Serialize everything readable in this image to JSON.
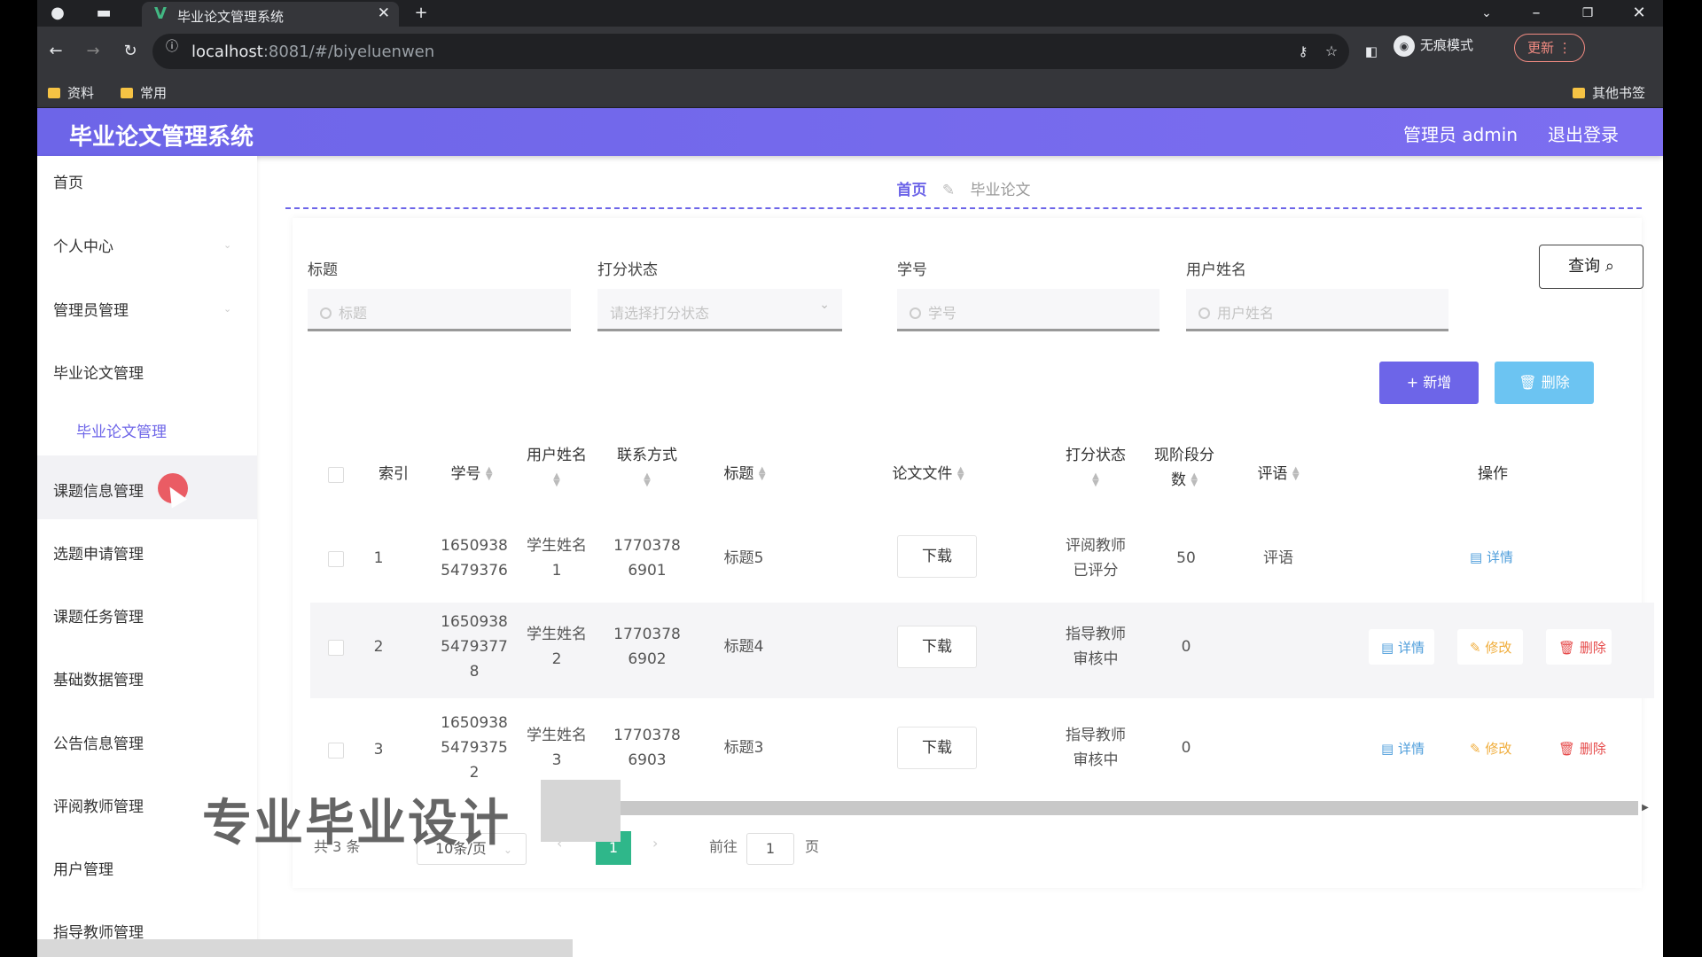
{
  "browser": {
    "tab_title": "毕业论文管理系统",
    "url_host": "localhost",
    "url_rest": ":8081/#/biyeluenwen",
    "bookmarks": [
      "资料",
      "常用"
    ],
    "other_bookmarks": "其他书签",
    "incognito_label": "无痕模式",
    "update_label": "更新"
  },
  "header": {
    "title": "毕业论文管理系统",
    "user": "管理员 admin",
    "logout": "退出登录"
  },
  "sidebar": {
    "items": [
      {
        "label": "首页"
      },
      {
        "label": "个人中心"
      },
      {
        "label": "管理员管理"
      },
      {
        "label": "毕业论文管理"
      },
      {
        "label": "毕业论文管理"
      },
      {
        "label": "课题信息管理"
      },
      {
        "label": "选题申请管理"
      },
      {
        "label": "课题任务管理"
      },
      {
        "label": "基础数据管理"
      },
      {
        "label": "公告信息管理"
      },
      {
        "label": "评阅教师管理"
      },
      {
        "label": "用户管理"
      },
      {
        "label": "指导教师管理"
      }
    ]
  },
  "breadcrumb": {
    "home": "首页",
    "current": "毕业论文"
  },
  "filters": {
    "title_label": "标题",
    "title_placeholder": "标题",
    "status_label": "打分状态",
    "status_placeholder": "请选择打分状态",
    "student_no_label": "学号",
    "student_no_placeholder": "学号",
    "username_label": "用户姓名",
    "username_placeholder": "用户姓名",
    "query": "查询"
  },
  "actions": {
    "add": "新增",
    "delete": "删除"
  },
  "table": {
    "headers": {
      "index": "索引",
      "student_no": "学号",
      "username": "用户姓名",
      "contact": "联系方式",
      "title": "标题",
      "file": "论文文件",
      "status": "打分状态",
      "score_a": "现阶段分",
      "score_b": "数",
      "comment": "评语",
      "ops": "操作"
    },
    "rows": [
      {
        "index": "1",
        "no1": "1650938",
        "no2": "5479376",
        "no3": "",
        "name1": "学生姓名",
        "name2": "1",
        "tel1": "1770378",
        "tel2": "6901",
        "title": "标题5",
        "file": "下载",
        "st1": "评阅教师",
        "st2": "已评分",
        "score": "50",
        "comment": "评语",
        "detail": "详情",
        "edit": "",
        "remove": ""
      },
      {
        "index": "2",
        "no1": "1650938",
        "no2": "5479377",
        "no3": "8",
        "name1": "学生姓名",
        "name2": "2",
        "tel1": "1770378",
        "tel2": "6902",
        "title": "标题4",
        "file": "下载",
        "st1": "指导教师",
        "st2": "审核中",
        "score": "0",
        "comment": "",
        "detail": "详情",
        "edit": "修改",
        "remove": "删除"
      },
      {
        "index": "3",
        "no1": "1650938",
        "no2": "5479375",
        "no3": "2",
        "name1": "学生姓名",
        "name2": "3",
        "tel1": "1770378",
        "tel2": "6903",
        "title": "标题3",
        "file": "下载",
        "st1": "指导教师",
        "st2": "审核中",
        "score": "0",
        "comment": "",
        "detail": "详情",
        "edit": "修改",
        "remove": "删除"
      }
    ]
  },
  "pagination": {
    "total": "共 3 条",
    "page_size": "10条/页",
    "current": "1",
    "goto_label": "前往",
    "goto_value": "1",
    "page_unit": "页"
  },
  "watermark": "专业毕业设计",
  "colors": {
    "primary": "#6d65e8",
    "info": "#6cc4f2",
    "success": "#2fb78a"
  }
}
